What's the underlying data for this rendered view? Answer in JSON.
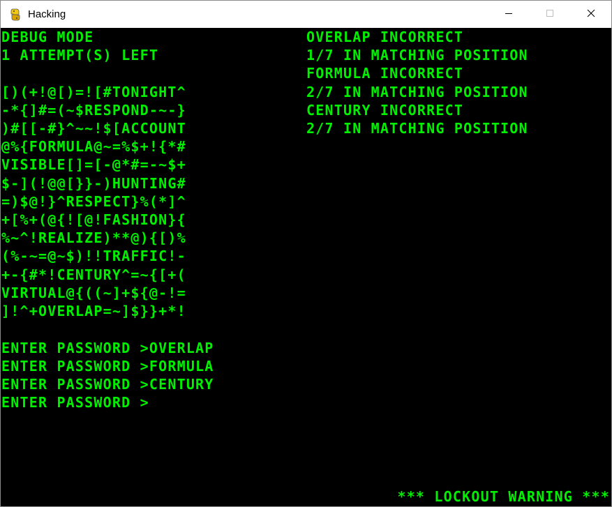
{
  "window": {
    "title": "Hacking"
  },
  "terminal": {
    "header": [
      "DEBUG MODE",
      "1 ATTEMPT(S) LEFT"
    ],
    "memory_dump": [
      "[)(+!@[)=![#TONIGHT^",
      "-*{]#=(~$RESPOND-~-}",
      ")#[[-#}^~~!$[ACCOUNT",
      "@%{FORMULA@~=%$+!{*#",
      "VISIBLE[]=[-@*#=-~$+",
      "$-](!@@[}}-)HUNTING#",
      "=)$@!}^RESPECT}%(*]^",
      "+[%+(@{![@!FASHION}{",
      "%~^!REALIZE)**@){[)%",
      "(%-~=@~$)!!TRAFFIC!-",
      "+-{#*!CENTURY^=~{[+(",
      "VIRTUAL@{((~]+${@-!=",
      "]!^+OVERLAP=~]$}}+*!"
    ],
    "attempts": [
      "ENTER PASSWORD >OVERLAP",
      "ENTER PASSWORD >FORMULA",
      "ENTER PASSWORD >CENTURY",
      "ENTER PASSWORD >"
    ],
    "feedback": [
      "OVERLAP INCORRECT",
      "1/7 IN MATCHING POSITION",
      "FORMULA INCORRECT",
      "2/7 IN MATCHING POSITION",
      "CENTURY INCORRECT",
      "2/7 IN MATCHING POSITION"
    ],
    "warning": "*** LOCKOUT WARNING ***"
  },
  "colors": {
    "terminal_text": "#00f000",
    "terminal_bg": "#000000"
  },
  "icons": {
    "app": "python-icon",
    "minimize": "minimize-icon",
    "maximize": "maximize-icon",
    "close": "close-icon"
  }
}
